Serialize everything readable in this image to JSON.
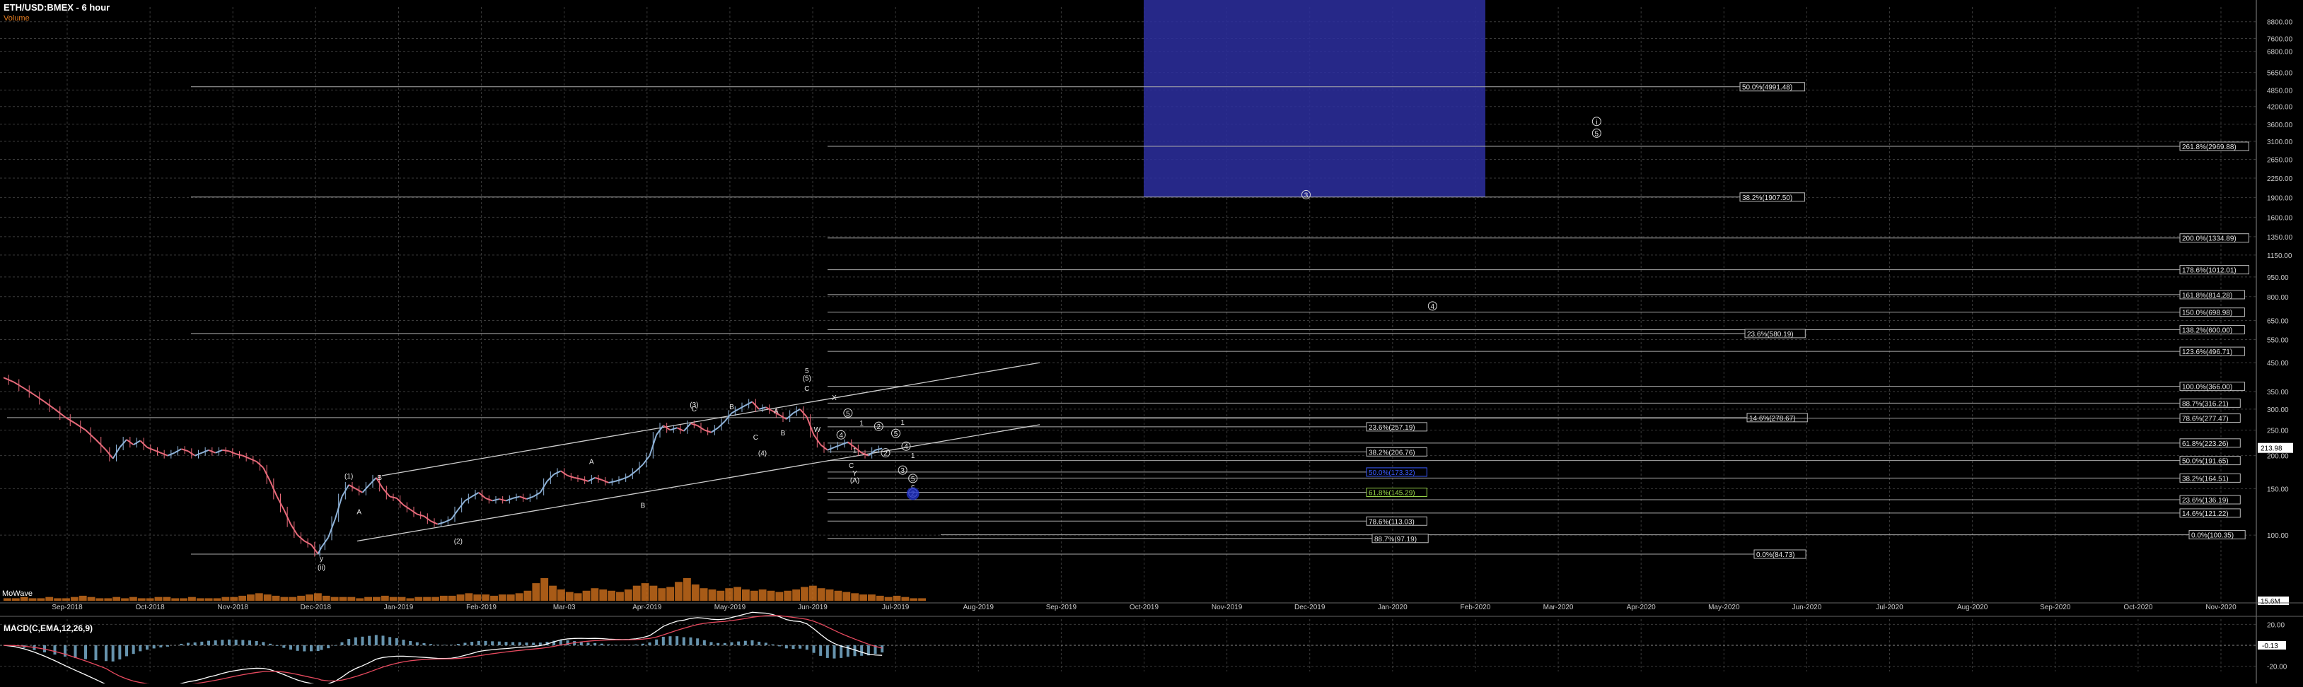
{
  "header": {
    "title": "ETH/USD:BMEX - 6 hour",
    "volume_label": "Volume",
    "volume_pane_label": "MoWave",
    "macd_label": "MACD(C,EMA,12,26,9)"
  },
  "colors": {
    "background": "#000000",
    "grid": "#3a3a3a",
    "candle_up": "#8fb3d9",
    "candle_down": "#e86a7a",
    "zone_blue": "#2d2fa0",
    "volume_orange": "#e07a1f",
    "macd_line": "#ffffff",
    "signal_line": "#e84a5f",
    "histogram": "#7fb8d8",
    "axis_text": "#cccccc"
  },
  "chart_data": [
    {
      "type": "line",
      "name_hint": "price-pane",
      "scale": "log",
      "ylim": [
        70,
        10000
      ],
      "x_tick_labels": [
        "Sep-2018",
        "Oct-2018",
        "Nov-2018",
        "Dec-2018",
        "Jan-2019",
        "Feb-2019",
        "Mar-03",
        "Apr-2019",
        "May-2019",
        "Jun-2019",
        "Jul-2019",
        "Aug-2019",
        "Sep-2019",
        "Oct-2019",
        "Nov-2019",
        "Dec-2019",
        "Jan-2020",
        "Feb-2020",
        "Mar-2020",
        "Apr-2020",
        "May-2020",
        "Jun-2020",
        "Jul-2020",
        "Aug-2020",
        "Sep-2020",
        "Oct-2020",
        "Nov-2020"
      ],
      "y_tick_labels": [
        {
          "v": 8800,
          "t": "8800.00"
        },
        {
          "v": 7600,
          "t": "7600.00"
        },
        {
          "v": 6800,
          "t": "6800.00"
        },
        {
          "v": 5650,
          "t": "5650.00"
        },
        {
          "v": 4850,
          "t": "4850.00"
        },
        {
          "v": 4200,
          "t": "4200.00"
        },
        {
          "v": 3600,
          "t": "3600.00"
        },
        {
          "v": 3100,
          "t": "3100.00"
        },
        {
          "v": 2650,
          "t": "2650.00"
        },
        {
          "v": 2250,
          "t": "2250.00"
        },
        {
          "v": 1900,
          "t": "1900.00"
        },
        {
          "v": 1600,
          "t": "1600.00"
        },
        {
          "v": 1350,
          "t": "1350.00"
        },
        {
          "v": 1150,
          "t": "1150.00"
        },
        {
          "v": 950,
          "t": "950.00"
        },
        {
          "v": 800,
          "t": "800.00"
        },
        {
          "v": 650,
          "t": "650.00"
        },
        {
          "v": 550,
          "t": "550.00"
        },
        {
          "v": 450,
          "t": "450.00"
        },
        {
          "v": 350,
          "t": "350.00"
        },
        {
          "v": 300,
          "t": "300.00"
        },
        {
          "v": 250,
          "t": "250.00"
        },
        {
          "v": 200,
          "t": "200.00"
        },
        {
          "v": 150,
          "t": "150.00"
        },
        {
          "v": 100,
          "t": "100.00"
        }
      ],
      "last_price_label": "213.98",
      "series": [
        {
          "values": [
            [
              0,
              395
            ],
            [
              3,
              380
            ],
            [
              6,
              360
            ],
            [
              9,
              340
            ],
            [
              12,
              320
            ],
            [
              15,
              300
            ],
            [
              18,
              280
            ],
            [
              21,
              265
            ],
            [
              24,
              250
            ],
            [
              27,
              230
            ],
            [
              30,
              210
            ],
            [
              32,
              195
            ],
            [
              34,
              215
            ],
            [
              36,
              230
            ],
            [
              38,
              220
            ],
            [
              40,
              228
            ],
            [
              42,
              215
            ],
            [
              44,
              210
            ],
            [
              46,
              205
            ],
            [
              48,
              200
            ],
            [
              50,
              205
            ],
            [
              52,
              212
            ],
            [
              54,
              208
            ],
            [
              56,
              200
            ],
            [
              58,
              205
            ],
            [
              60,
              210
            ],
            [
              62,
              205
            ],
            [
              64,
              210
            ],
            [
              66,
              208
            ],
            [
              68,
              203
            ],
            [
              70,
              200
            ],
            [
              72,
              195
            ],
            [
              74,
              190
            ],
            [
              76,
              180
            ],
            [
              78,
              160
            ],
            [
              80,
              140
            ],
            [
              82,
              125
            ],
            [
              84,
              110
            ],
            [
              86,
              100
            ],
            [
              88,
              95
            ],
            [
              90,
              92
            ],
            [
              92,
              85
            ],
            [
              93,
              90
            ],
            [
              95,
              98
            ],
            [
              97,
              115
            ],
            [
              99,
              140
            ],
            [
              101,
              155
            ],
            [
              103,
              150
            ],
            [
              105,
              145
            ],
            [
              107,
              155
            ],
            [
              109,
              165
            ],
            [
              111,
              150
            ],
            [
              113,
              140
            ],
            [
              115,
              138
            ],
            [
              117,
              130
            ],
            [
              119,
              125
            ],
            [
              121,
              120
            ],
            [
              123,
              118
            ],
            [
              125,
              113
            ],
            [
              127,
              110
            ],
            [
              129,
              112
            ],
            [
              131,
              115
            ],
            [
              133,
              125
            ],
            [
              135,
              135
            ],
            [
              137,
              140
            ],
            [
              139,
              145
            ],
            [
              141,
              138
            ],
            [
              143,
              135
            ],
            [
              145,
              137
            ],
            [
              147,
              135
            ],
            [
              149,
              138
            ],
            [
              151,
              140
            ],
            [
              153,
              137
            ],
            [
              155,
              140
            ],
            [
              157,
              145
            ],
            [
              159,
              160
            ],
            [
              161,
              170
            ],
            [
              163,
              175
            ],
            [
              165,
              168
            ],
            [
              167,
              165
            ],
            [
              169,
              163
            ],
            [
              171,
              160
            ],
            [
              173,
              165
            ],
            [
              175,
              162
            ],
            [
              177,
              158
            ],
            [
              179,
              160
            ],
            [
              181,
              163
            ],
            [
              183,
              167
            ],
            [
              185,
              175
            ],
            [
              187,
              185
            ],
            [
              189,
              200
            ],
            [
              191,
              240
            ],
            [
              193,
              260
            ],
            [
              195,
              250
            ],
            [
              197,
              255
            ],
            [
              199,
              248
            ],
            [
              201,
              265
            ],
            [
              203,
              260
            ],
            [
              205,
              250
            ],
            [
              207,
              245
            ],
            [
              209,
              255
            ],
            [
              211,
              270
            ],
            [
              213,
              290
            ],
            [
              215,
              300
            ],
            [
              217,
              310
            ],
            [
              219,
              320
            ],
            [
              221,
              300
            ],
            [
              223,
              305
            ],
            [
              225,
              295
            ],
            [
              227,
              285
            ],
            [
              229,
              275
            ],
            [
              231,
              290
            ],
            [
              233,
              300
            ],
            [
              235,
              280
            ],
            [
              237,
              240
            ],
            [
              239,
              220
            ],
            [
              241,
              210
            ],
            [
              243,
              215
            ],
            [
              245,
              220
            ],
            [
              247,
              225
            ],
            [
              249,
              215
            ],
            [
              251,
              205
            ],
            [
              253,
              200
            ],
            [
              255,
              210
            ],
            [
              257,
              213
            ]
          ]
        }
      ],
      "fib_levels": [
        {
          "price": 4991.48,
          "label": "50.0%(4991.48)"
        },
        {
          "price": 2969.88,
          "label": "261.8%(2969.88)"
        },
        {
          "price": 1907.5,
          "label": "38.2%(1907.50)"
        },
        {
          "price": 1334.89,
          "label": "200.0%(1334.89)"
        },
        {
          "price": 1012.01,
          "label": "178.6%(1012.01)"
        },
        {
          "price": 814.28,
          "label": "161.8%(814.28)"
        },
        {
          "price": 698.98,
          "label": "150.0%(698.98)"
        },
        {
          "price": 600.0,
          "label": "138.2%(600.00)"
        },
        {
          "price": 580.19,
          "label": "23.6%(580.19)"
        },
        {
          "price": 496.71,
          "label": "123.6%(496.71)"
        },
        {
          "price": 366.0,
          "label": "100.0%(366.00)"
        },
        {
          "price": 316.21,
          "label": "88.7%(316.21)"
        },
        {
          "price": 278.67,
          "label": "14.6%(278.67)"
        },
        {
          "price": 277.47,
          "label": "78.6%(277.47)"
        },
        {
          "price": 257.19,
          "label": "23.6%(257.19)"
        },
        {
          "price": 223.26,
          "label": "61.8%(223.26)"
        },
        {
          "price": 206.76,
          "label": "38.2%(206.76)"
        },
        {
          "price": 191.65,
          "label": "50.0%(191.65)"
        },
        {
          "price": 173.32,
          "label": "50.0%(173.32)"
        },
        {
          "price": 164.51,
          "label": "38.2%(164.51)"
        },
        {
          "price": 145.29,
          "label": "61.8%(145.29)"
        },
        {
          "price": 136.19,
          "label": "23.6%(136.19)"
        },
        {
          "price": 121.22,
          "label": "14.6%(121.22)"
        },
        {
          "price": 113.03,
          "label": "78.6%(113.03)"
        },
        {
          "price": 100.35,
          "label": "0.0%(100.35)"
        },
        {
          "price": 97.19,
          "label": "88.7%(97.19)"
        },
        {
          "price": 84.73,
          "label": "0.0%(84.73)"
        }
      ],
      "wave_labels": [
        {
          "t": 93,
          "price": 80,
          "text": "y"
        },
        {
          "t": 93,
          "price": 74,
          "text": "(ii)"
        },
        {
          "t": 101,
          "price": 164,
          "text": "(1)"
        },
        {
          "t": 110,
          "price": 162,
          "text": "B"
        },
        {
          "t": 104,
          "price": 120,
          "text": "A"
        },
        {
          "t": 133,
          "price": 93,
          "text": "(2)"
        },
        {
          "t": 172,
          "price": 186,
          "text": "A"
        },
        {
          "t": 187,
          "price": 127,
          "text": "B"
        },
        {
          "t": 202,
          "price": 305,
          "text": "(3)"
        },
        {
          "t": 202,
          "price": 294,
          "text": "C"
        },
        {
          "t": 213,
          "price": 300,
          "text": "B"
        },
        {
          "t": 222,
          "price": 200,
          "text": "(4)"
        },
        {
          "t": 220,
          "price": 230,
          "text": "C"
        },
        {
          "t": 226,
          "price": 289,
          "text": "A"
        },
        {
          "t": 228,
          "price": 239,
          "text": "B"
        },
        {
          "t": 235,
          "price": 410,
          "text": "5"
        },
        {
          "t": 235,
          "price": 385,
          "text": "(5)"
        },
        {
          "t": 235,
          "price": 352,
          "text": "C"
        },
        {
          "t": 243,
          "price": 325,
          "text": "X"
        },
        {
          "t": 247,
          "price": 283,
          "text": "5"
        },
        {
          "t": 238,
          "price": 246,
          "text": "W"
        },
        {
          "t": 251,
          "price": 260,
          "text": "1"
        },
        {
          "t": 256,
          "price": 252,
          "text": "2"
        },
        {
          "t": 245,
          "price": 234,
          "text": "4"
        },
        {
          "t": 249,
          "price": 205,
          "text": "1"
        },
        {
          "t": 248,
          "price": 180,
          "text": "C"
        },
        {
          "t": 249,
          "price": 168,
          "text": "Y"
        },
        {
          "t": 249,
          "price": 158,
          "text": "(A)"
        },
        {
          "t": 261,
          "price": 237,
          "text": "5"
        },
        {
          "t": 264,
          "price": 212,
          "text": "4"
        },
        {
          "t": 263,
          "price": 262,
          "text": "1"
        },
        {
          "t": 258,
          "price": 200,
          "text": "2"
        },
        {
          "t": 266,
          "price": 196,
          "text": "1"
        },
        {
          "t": 263,
          "price": 172,
          "text": "3"
        },
        {
          "t": 266,
          "price": 160,
          "text": "5"
        },
        {
          "t": 266,
          "price": 150,
          "text": "c"
        },
        {
          "t": 266,
          "price": 141,
          "text": "2"
        },
        {
          "t": 381,
          "price": 1900,
          "text": "3"
        },
        {
          "t": 418,
          "price": 720,
          "text": "4"
        },
        {
          "t": 466,
          "price": 3600,
          "text": "i"
        },
        {
          "t": 466,
          "price": 3250,
          "text": "5"
        }
      ]
    },
    {
      "type": "bar",
      "name_hint": "volume-pane",
      "last_value_label": "15.6M",
      "values": [
        2,
        2,
        3,
        2,
        2,
        3,
        2,
        2,
        3,
        4,
        3,
        2,
        2,
        3,
        2,
        3,
        2,
        2,
        3,
        3,
        2,
        2,
        3,
        2,
        2,
        2,
        3,
        3,
        4,
        5,
        6,
        5,
        4,
        3,
        3,
        4,
        5,
        6,
        4,
        3,
        3,
        3,
        2,
        3,
        3,
        4,
        3,
        3,
        2,
        3,
        3,
        3,
        4,
        4,
        5,
        6,
        5,
        5,
        4,
        5,
        5,
        6,
        8,
        14,
        18,
        12,
        9,
        7,
        6,
        8,
        10,
        9,
        8,
        7,
        9,
        12,
        14,
        12,
        10,
        11,
        15,
        18,
        13,
        10,
        9,
        8,
        10,
        11,
        9,
        8,
        9,
        8,
        7,
        8,
        9,
        11,
        12,
        10,
        9,
        8,
        7,
        6,
        5,
        5,
        4,
        3,
        4,
        3,
        2,
        2
      ]
    },
    {
      "type": "line",
      "name_hint": "macd-pane",
      "y_tick_labels": [
        "20.00",
        "-0.13",
        "-20.00"
      ],
      "current_value_label": "-0.13"
    }
  ]
}
